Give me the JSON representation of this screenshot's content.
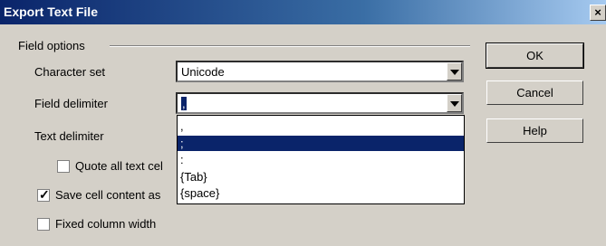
{
  "window": {
    "title": "Export Text File",
    "close_label": "×"
  },
  "field_options": {
    "title": "Field options",
    "character_set": {
      "label": "Character set",
      "value": "Unicode"
    },
    "field_delimiter": {
      "label": "Field delimiter",
      "value": ","
    },
    "text_delimiter": {
      "label": "Text delimiter"
    },
    "checkboxes": [
      {
        "label": "Quote all text cel",
        "checked": false
      },
      {
        "label": "Save cell content as",
        "checked": true
      },
      {
        "label": "Fixed column width",
        "checked": false
      }
    ]
  },
  "dropdown": {
    "options": [
      ",",
      ";",
      ":",
      "{Tab}",
      "{space}"
    ],
    "selected_index": 1
  },
  "buttons": {
    "ok": "OK",
    "cancel": "Cancel",
    "help": "Help"
  },
  "colors": {
    "titlebar": "#0a246a",
    "selection": "#0a246a",
    "face": "#d4d0c8"
  }
}
